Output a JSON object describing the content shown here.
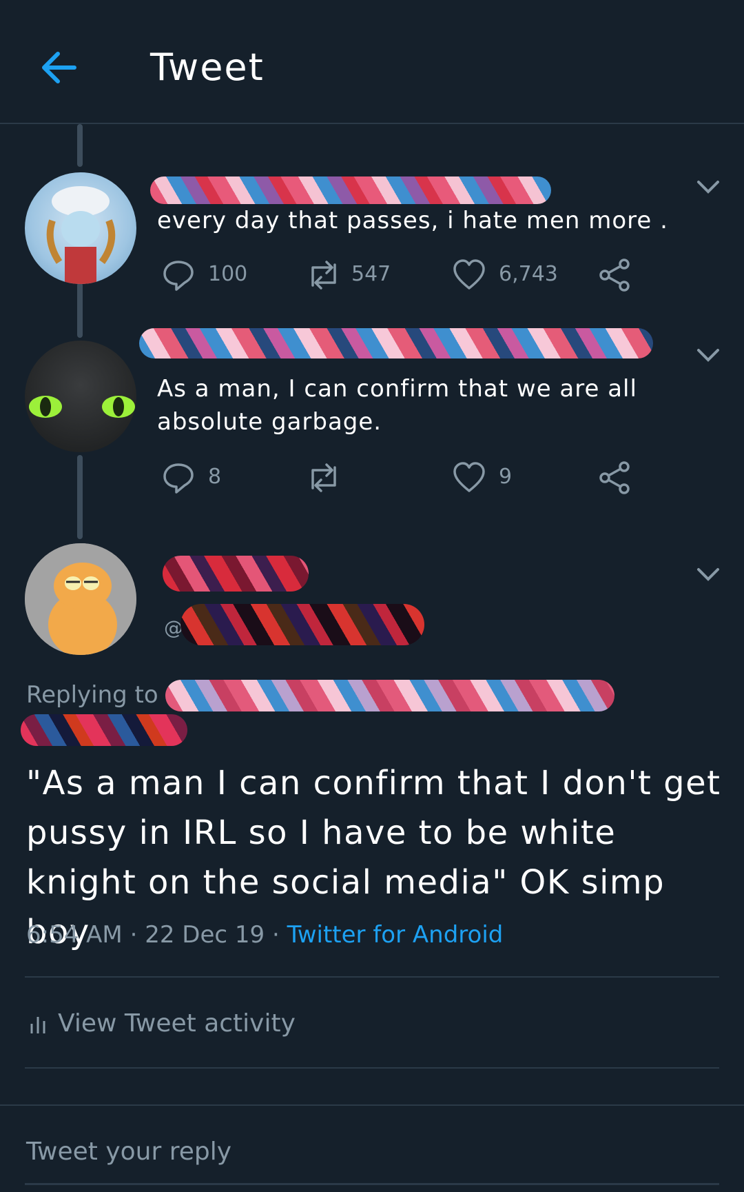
{
  "header": {
    "title": "Tweet"
  },
  "thread": [
    {
      "text": "every day that passes, i hate men more .",
      "counts": {
        "replies": "100",
        "retweets": "547",
        "likes": "6,743"
      }
    },
    {
      "text": "As a man, I can confirm that we are all absolute garbage.",
      "counts": {
        "replies": "8",
        "retweets": "",
        "likes": "9"
      }
    }
  ],
  "main_tweet": {
    "handle_prefix": "@",
    "replying_to_label": "Replying to",
    "text": "\"As a man I can confirm that I don't get pussy in IRL so I have to be white knight on the social media\" OK simp boy",
    "time": "6:54 AM",
    "date": "22 Dec 19",
    "separator": "·",
    "source": "Twitter for Android"
  },
  "activity": {
    "label": "View Tweet activity"
  },
  "reply_box": {
    "placeholder": "Tweet your reply"
  },
  "colors": {
    "background": "#15202b",
    "accent": "#1da1f2",
    "muted": "#8899a6",
    "divider": "#2b3a48"
  }
}
